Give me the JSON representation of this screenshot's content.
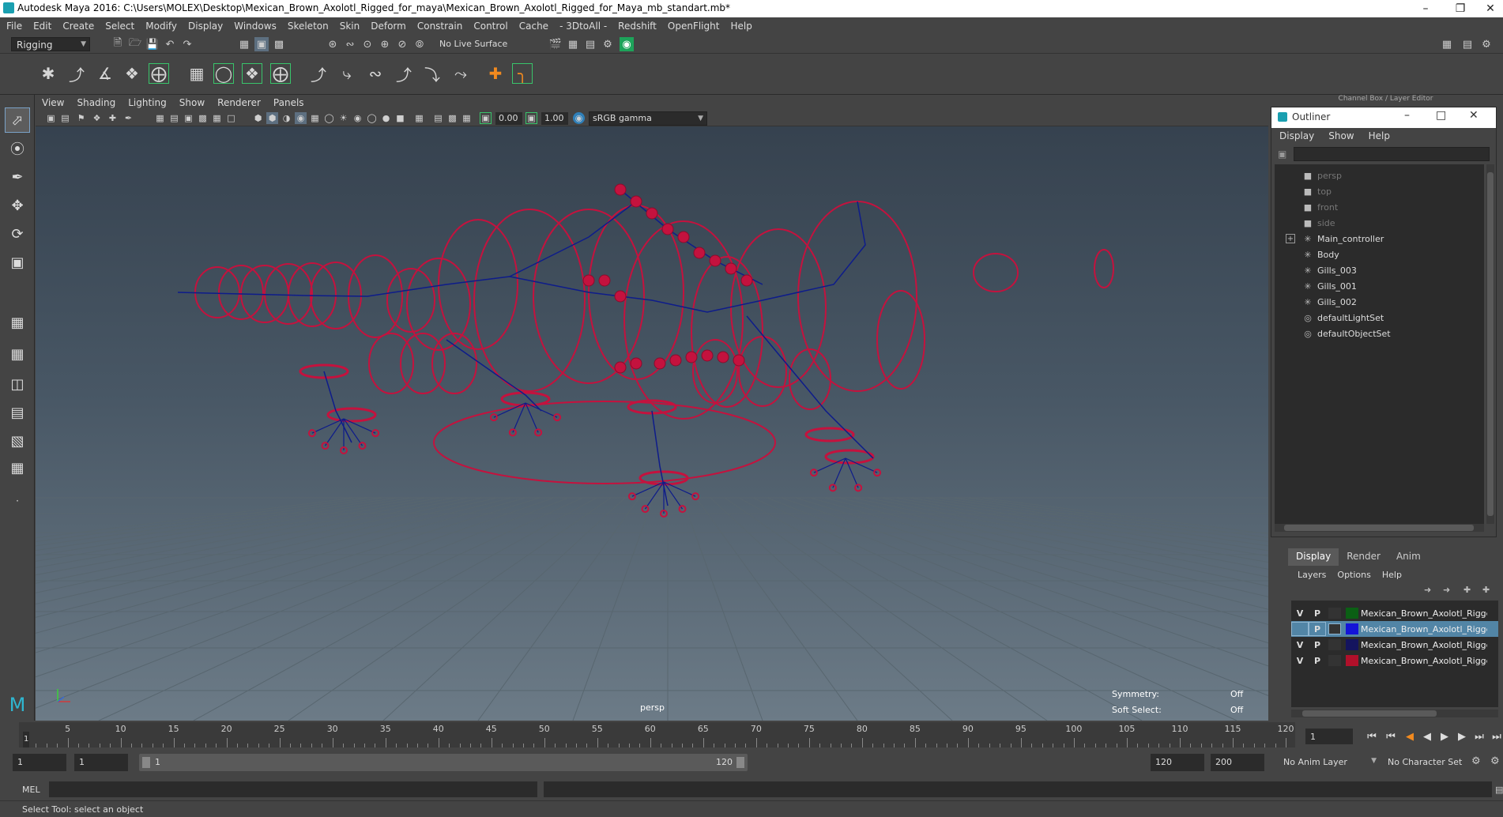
{
  "window": {
    "title": "Autodesk Maya 2016: C:\\Users\\MOLEX\\Desktop\\Mexican_Brown_Axolotl_Rigged_for_maya\\Mexican_Brown_Axolotl_Rigged_for_Maya_mb_standart.mb*"
  },
  "menubar": [
    "File",
    "Edit",
    "Create",
    "Select",
    "Modify",
    "Display",
    "Windows",
    "Skeleton",
    "Skin",
    "Deform",
    "Constrain",
    "Control",
    "Cache",
    "- 3DtoAll -",
    "Redshift",
    "OpenFlight",
    "Help"
  ],
  "statusline": {
    "mode": "Rigging",
    "live_surface": "No Live Surface"
  },
  "panel": {
    "menu": [
      "View",
      "Shading",
      "Lighting",
      "Show",
      "Renderer",
      "Panels"
    ],
    "exposure": "0.00",
    "gamma": "1.00",
    "colorspace": "sRGB gamma",
    "camera_label": "persp",
    "symmetry_label": "Symmetry:",
    "symmetry_value": "Off",
    "soft_select_label": "Soft Select:",
    "soft_select_value": "Off"
  },
  "channel_box_label": "Channel Box / Layer Editor",
  "outliner": {
    "title": "Outliner",
    "menu": [
      "Display",
      "Show",
      "Help"
    ],
    "items": [
      {
        "label": "persp",
        "kind": "camera",
        "dim": true,
        "expand": false
      },
      {
        "label": "top",
        "kind": "camera",
        "dim": true,
        "expand": false
      },
      {
        "label": "front",
        "kind": "camera",
        "dim": true,
        "expand": false
      },
      {
        "label": "side",
        "kind": "camera",
        "dim": true,
        "expand": false
      },
      {
        "label": "Main_controller",
        "kind": "transform",
        "dim": false,
        "expand": true
      },
      {
        "label": "Body",
        "kind": "transform",
        "dim": false,
        "expand": false
      },
      {
        "label": "Gills_003",
        "kind": "transform",
        "dim": false,
        "expand": false
      },
      {
        "label": "Gills_001",
        "kind": "transform",
        "dim": false,
        "expand": false
      },
      {
        "label": "Gills_002",
        "kind": "transform",
        "dim": false,
        "expand": false
      },
      {
        "label": "defaultLightSet",
        "kind": "set",
        "dim": false,
        "expand": false
      },
      {
        "label": "defaultObjectSet",
        "kind": "set",
        "dim": false,
        "expand": false
      }
    ]
  },
  "layer_editor": {
    "tabs": [
      "Display",
      "Render",
      "Anim"
    ],
    "active_tab": "Display",
    "menu": [
      "Layers",
      "Options",
      "Help"
    ],
    "layers": [
      {
        "v": "V",
        "p": "P",
        "color": "#0b5f14",
        "name": "Mexican_Brown_Axolotl_Rigged_",
        "selected": false
      },
      {
        "v": "",
        "p": "P",
        "color": "#1414d8",
        "name": "Mexican_Brown_Axolotl_Rigged",
        "selected": true
      },
      {
        "v": "V",
        "p": "P",
        "color": "#14145e",
        "name": "Mexican_Brown_Axolotl_Rigged_",
        "selected": false
      },
      {
        "v": "V",
        "p": "P",
        "color": "#b0102a",
        "name": "Mexican_Brown_Axolotl_Rigged_",
        "selected": false
      }
    ]
  },
  "timeline": {
    "ticks": [
      1,
      5,
      10,
      15,
      20,
      25,
      30,
      35,
      40,
      45,
      50,
      55,
      60,
      65,
      70,
      75,
      80,
      85,
      90,
      95,
      100,
      105,
      110,
      115,
      120
    ],
    "tick_labels": [
      "5",
      "10",
      "15",
      "20",
      "25",
      "30",
      "35",
      "40",
      "45",
      "50",
      "55",
      "60",
      "65",
      "70",
      "75",
      "80",
      "85",
      "90",
      "95",
      "100",
      "105",
      "110",
      "115",
      "120"
    ],
    "current_frame_marker": "1",
    "current_frame": "1"
  },
  "range": {
    "start": "1",
    "start_inner": "1",
    "slider_start": "1",
    "slider_end": "120",
    "end_inner": "120",
    "end": "200",
    "anim_layer": "No Anim Layer",
    "character_set": "No Character Set"
  },
  "cmdline": {
    "label": "MEL"
  },
  "helpline": "Select Tool: select an object",
  "colors": {
    "wire": "#c4123e",
    "joint": "#0e1c8a",
    "grid": "#58666f"
  }
}
